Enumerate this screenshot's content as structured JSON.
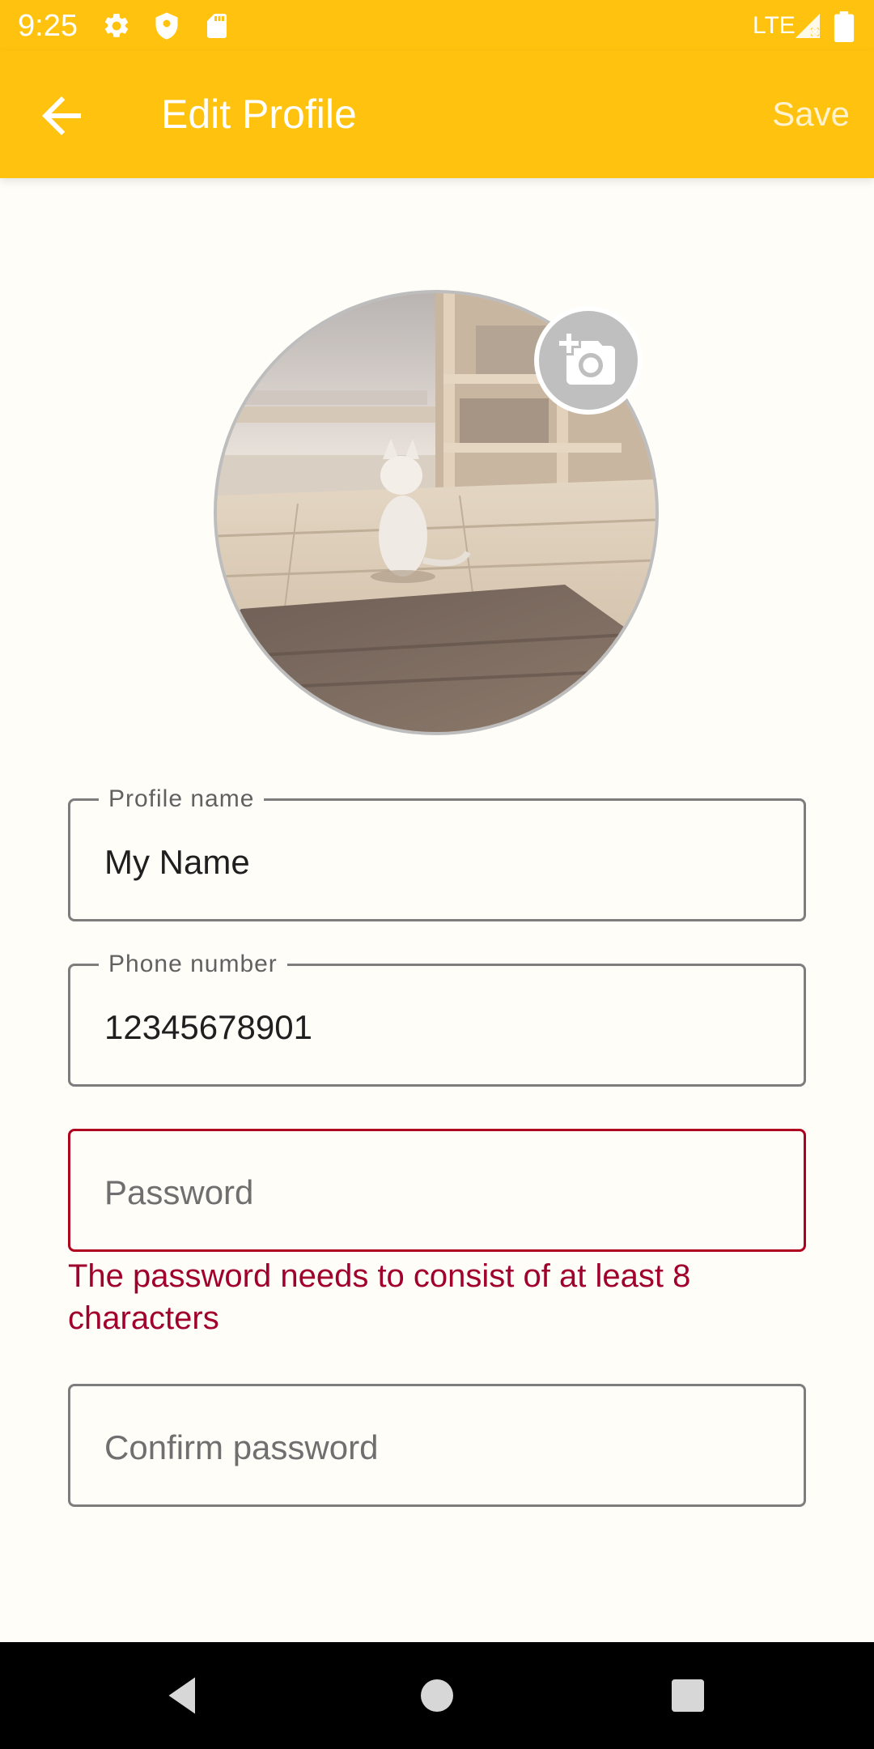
{
  "status_bar": {
    "time": "9:25",
    "network": "LTE",
    "icons": [
      "settings-icon",
      "shield-icon",
      "sd-card-icon",
      "signal-icon",
      "battery-icon"
    ]
  },
  "app_bar": {
    "title": "Edit Profile",
    "save_label": "Save",
    "back_icon": "arrow-back-icon",
    "background_color": "#FFC30F"
  },
  "avatar": {
    "description": "profile photo",
    "badge_icon": "add-photo-camera-icon"
  },
  "form": {
    "profile_name": {
      "label": "Profile name",
      "value": "My Name"
    },
    "phone_number": {
      "label": "Phone number",
      "value": "12345678901"
    },
    "password": {
      "placeholder": "Password",
      "error": "The password needs to consist of at least 8 characters"
    },
    "confirm_password": {
      "placeholder": "Confirm password"
    }
  },
  "colors": {
    "accent": "#FFC30F",
    "error": "#A1002C",
    "outline": "#7D7D7D"
  },
  "nav_bar": {
    "buttons": [
      "back-triangle-icon",
      "home-circle-icon",
      "recents-square-icon"
    ]
  }
}
